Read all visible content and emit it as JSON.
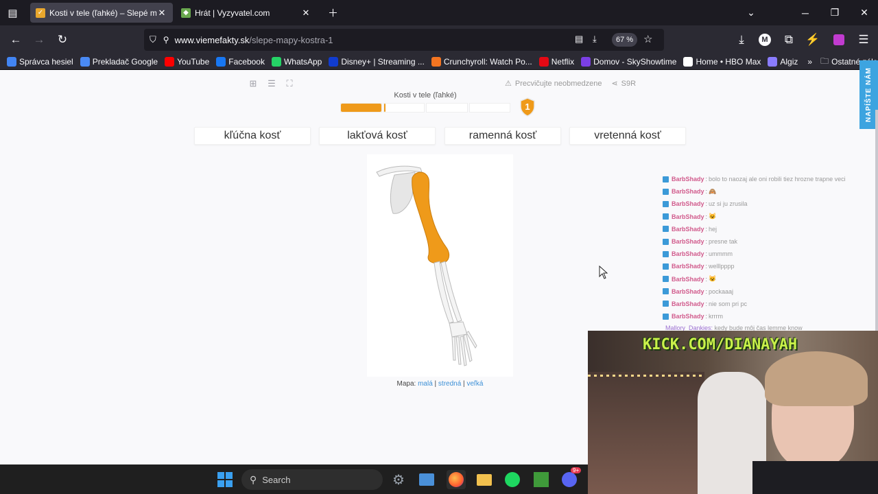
{
  "browser": {
    "tabs": [
      {
        "title": "Kosti v tele (ľahké) – Slepé mapy",
        "active": true
      },
      {
        "title": "Hrát | Vyzyvatel.com",
        "active": false
      }
    ],
    "url_host": "www.viemefakty.sk",
    "url_path": "/slepe-mapy-kostra-1",
    "zoom": "67 %"
  },
  "bookmarks": [
    {
      "label": "Správca hesiel",
      "icon": "google-icon",
      "color": "#4285f4"
    },
    {
      "label": "Prekladač Google",
      "icon": "translate-icon",
      "color": "#4a8af4"
    },
    {
      "label": "YouTube",
      "icon": "youtube-icon",
      "color": "#ff0000"
    },
    {
      "label": "Facebook",
      "icon": "facebook-icon",
      "color": "#1877f2"
    },
    {
      "label": "WhatsApp",
      "icon": "whatsapp-icon",
      "color": "#25d366"
    },
    {
      "label": "Disney+ | Streaming ...",
      "icon": "disney-icon",
      "color": "#113ccf"
    },
    {
      "label": "Crunchyroll: Watch Po...",
      "icon": "crunchyroll-icon",
      "color": "#f47521"
    },
    {
      "label": "Netflix",
      "icon": "netflix-icon",
      "color": "#e50914"
    },
    {
      "label": "Domov - SkyShowtime",
      "icon": "skyshowtime-icon",
      "color": "#7b3fe4"
    },
    {
      "label": "Home • HBO Max",
      "icon": "hbo-icon",
      "color": "#ffffff"
    },
    {
      "label": "Algiz",
      "icon": "algiz-icon",
      "color": "#8a7cff"
    }
  ],
  "bookmarks_more": "»",
  "other_bookmarks": "Ostatné záložky",
  "quiz": {
    "title": "Kosti v tele (ľahké)",
    "practice": "Precvičujte neobmedzene",
    "share": "S9R",
    "progress": 0.26,
    "level": "1",
    "choices": [
      "kľúčna kosť",
      "lakťová kosť",
      "ramenná kosť",
      "vretenná kosť"
    ],
    "map_label": "Mapa:",
    "map_sizes": [
      "malá",
      "stredná",
      "veľká"
    ],
    "highlight_color": "#ef9a1a"
  },
  "feedback_tab": "NAPÍŠTE NÁM",
  "chat": {
    "user": "BarbShady",
    "messages": [
      "bolo to naozaj ale oni robili tiez hrozne trapne veci",
      "🙈",
      "uz si ju zrusila",
      "😺",
      "hej",
      "presne tak",
      "ummmm",
      "welllpppp",
      "😺",
      "pockaaaj",
      "nie som pri pc",
      "krrrm"
    ],
    "last_user": "Mallory_Dankies",
    "last_msg": "kedy bude môj čas lemme know"
  },
  "webcam_banner": "KICK.COM/DIANAYAH",
  "taskbar": {
    "search": "Search",
    "apps": [
      "windows-icon",
      "settings-icon",
      "control-panel-icon",
      "firefox-icon",
      "file-explorer-icon",
      "spotify-icon",
      "minecraft-icon",
      "discord-icon"
    ],
    "discord_badge": "9+"
  }
}
